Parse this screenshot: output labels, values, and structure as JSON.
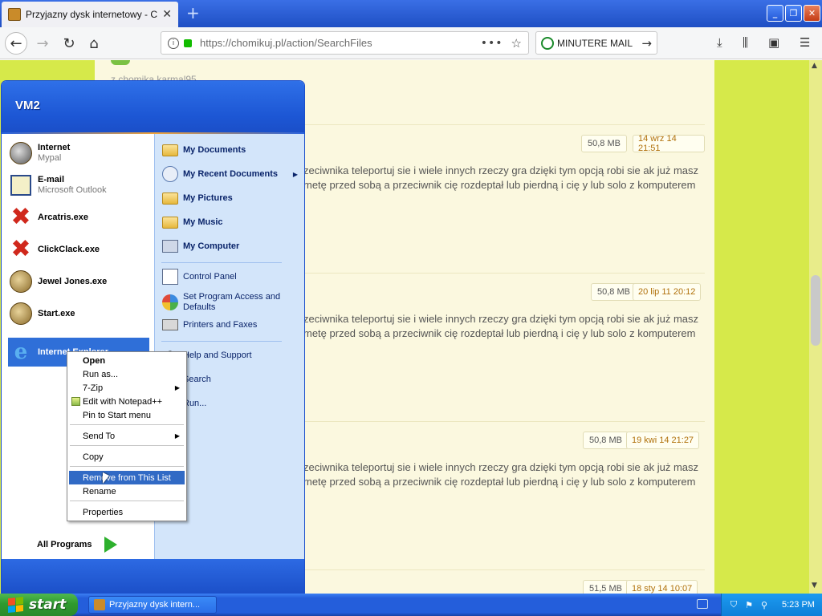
{
  "browser": {
    "tab_title": "Przyjazny dysk internetowy - Cho",
    "new_tab": "+",
    "url": "https://chomikuj.pl/action/SearchFiles",
    "search_query": "MINUTERE MAIL",
    "icons": [
      "back-icon",
      "forward-icon",
      "reload-icon",
      "home-icon",
      "info-icon",
      "lock-icon",
      "more-icon",
      "star-icon",
      "download-icon",
      "library-icon",
      "sidebar-icon",
      "menu-icon"
    ]
  },
  "page": {
    "top_fragment": "z chomika karmal95",
    "results": [
      {
        "size": "50,8 MB",
        "date": "14 wrz 14 21:51",
        "description": "zeciwnika teleportuj sie i wiele innych rzeczy gra dzięki tym opcją robi sie ak już masz metę przed sobą a przeciwnik cię rozdeptał lub pierdną i cię y lub solo z komputerem"
      },
      {
        "size": "50,8 MB",
        "date": "20 lip 11 20:12",
        "description": "zeciwnika teleportuj sie i wiele innych rzeczy gra dzięki tym opcją robi sie ak już masz metę przed sobą a przeciwnik cię rozdeptał lub pierdną i cię y lub solo z komputerem"
      },
      {
        "size": "50,8 MB",
        "date": "19 kwi 14 21:27",
        "description": "zeciwnika teleportuj sie i wiele innych rzeczy gra dzięki tym opcją robi sie ak już masz metę przed sobą a przeciwnik cię rozdeptał lub pierdną i cię y lub solo z komputerem"
      },
      {
        "size": "51,5 MB",
        "date": "18 sty 14 10:07",
        "description": ""
      }
    ]
  },
  "startmenu": {
    "user": "VM2",
    "left_items": [
      {
        "label": "Internet",
        "sub": "Mypal",
        "icon": "raccoon-icon"
      },
      {
        "label": "E-mail",
        "sub": "Microsoft Outlook",
        "icon": "outlook-icon"
      },
      {
        "label": "Arcatris.exe",
        "sub": "",
        "icon": "red-x-icon"
      },
      {
        "label": "ClickClack.exe",
        "sub": "",
        "icon": "red-x-icon"
      },
      {
        "label": "Jewel Jones.exe",
        "sub": "",
        "icon": "jones-icon"
      },
      {
        "label": "Start.exe",
        "sub": "",
        "icon": "jones-icon"
      },
      {
        "label": "Internet Explorer",
        "sub": "",
        "icon": "ie-icon"
      }
    ],
    "all_programs": "All Programs",
    "right_items": [
      {
        "label": "My Documents",
        "bold": true
      },
      {
        "label": "My Recent Documents",
        "bold": true,
        "submenu": true
      },
      {
        "label": "My Pictures",
        "bold": true
      },
      {
        "label": "My Music",
        "bold": true
      },
      {
        "label": "My Computer",
        "bold": true
      },
      {
        "label": "Control Panel",
        "bold": false
      },
      {
        "label": "Set Program Access and Defaults",
        "bold": false
      },
      {
        "label": "Printers and Faxes",
        "bold": false
      },
      {
        "label": "Help and Support",
        "bold": false
      },
      {
        "label": "Search",
        "bold": false
      },
      {
        "label": "Run...",
        "bold": false
      }
    ]
  },
  "context_menu": {
    "items": [
      "Open",
      "Run as...",
      "7-Zip",
      "Edit with Notepad++",
      "Pin to Start menu",
      "Send To",
      "Copy",
      "Remove from This List",
      "Rename",
      "Properties"
    ],
    "selected": "Remove from This List"
  },
  "taskbar": {
    "start_label": "start",
    "task_title": "Przyjazny dysk intern...",
    "clock": "5:23 PM"
  },
  "colors": {
    "xp_blue": "#245edb",
    "start_green": "#2f9a2f",
    "page_bg": "#fbf8df",
    "page_side": "#d6e94a",
    "menu_highlight": "#316ac5"
  }
}
